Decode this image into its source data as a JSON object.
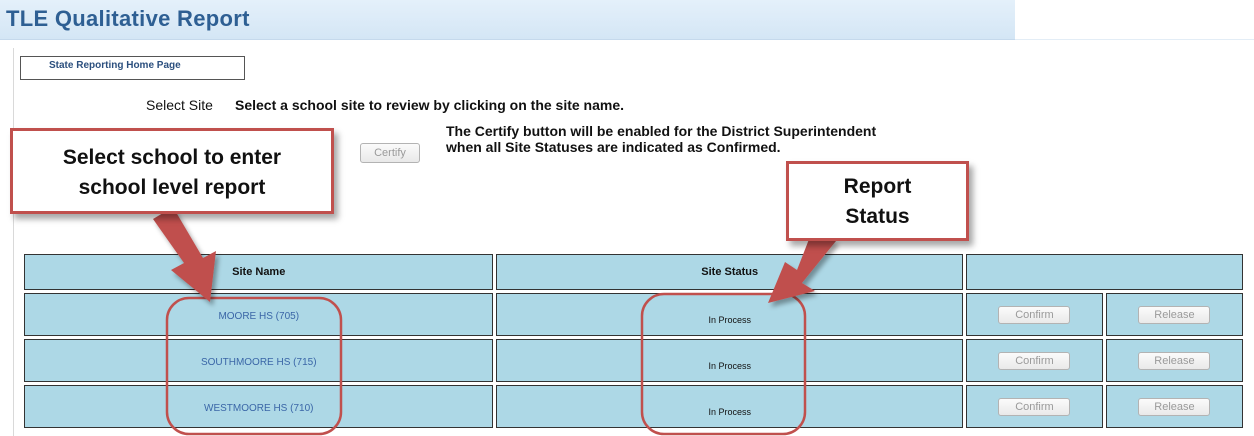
{
  "page": {
    "title": "TLE Qualitative Report",
    "home_link": "State Reporting Home Page"
  },
  "select_site": {
    "label": "Select Site",
    "instruction": "Select a school site to review by clicking on the site name."
  },
  "certify": {
    "button_label": "Certify",
    "note": "The Certify button will be enabled for the District Superintendent when all Site Statuses are indicated as Confirmed."
  },
  "callouts": {
    "left_line1": "Select school to enter",
    "left_line2": "school level report",
    "right_line1": "Report",
    "right_line2": "Status"
  },
  "table": {
    "headers": {
      "site_name": "Site Name",
      "site_status": "Site Status"
    },
    "rows": [
      {
        "name": "MOORE HS (705)",
        "status": "In Process",
        "confirm": "Confirm",
        "release": "Release"
      },
      {
        "name": "SOUTHMOORE HS (715)",
        "status": "In Process",
        "confirm": "Confirm",
        "release": "Release"
      },
      {
        "name": "WESTMOORE HS (710)",
        "status": "In Process",
        "confirm": "Confirm",
        "release": "Release"
      }
    ]
  },
  "colors": {
    "title": "#2e5f93",
    "table_cell": "#add8e6",
    "link": "#3a66a7",
    "annotation": "#c0504d"
  }
}
